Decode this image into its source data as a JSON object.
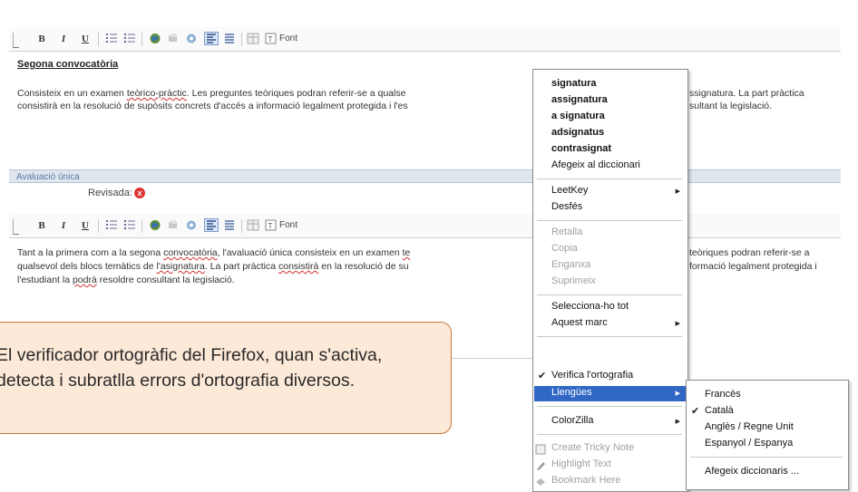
{
  "toolbar": {
    "bold": "B",
    "italic": "I",
    "underline": "U",
    "font": "Font"
  },
  "segona": {
    "heading": "Segona convocatòria",
    "line1_a": "Consisteix en un examen ",
    "line1_b": "teòrico-pràctic",
    "line1_c": ". Les preguntes teòriques podran referir-se a qualse",
    "line1_d": "ssignatura. La part pràctica",
    "line2_a": "consistirà en la resolució de supòsits concrets d'accés a informació legalment protegida i l'es",
    "line2_b": "sultant la legislació."
  },
  "section": {
    "title": "Avaluació única",
    "revisada_label": "Revisada:",
    "revisada_icon": "x"
  },
  "unica": {
    "line1_a": "Tant a la primera com a la segona ",
    "line1_b": "convocatòria",
    "line1_c": ", l'avaluació única consisteix en un examen ",
    "line1_d": "te",
    "line1_e": "teòriques podran referir-se a",
    "line2_a": "qualsevol dels blocs temàtics de ",
    "line2_b": "l'asignatura",
    "line2_c": ". La part pràctica ",
    "line2_d": "consistirà",
    "line2_e": " en la resolució de su",
    "line2_f": "formació legalment protegida i",
    "line3_a": "l'estudiant la ",
    "line3_b": "podrà",
    "line3_c": " resoldre consultant la legislació."
  },
  "callout": {
    "text": "El verificador ortogràfic del Firefox, quan s'activa, detecta i subratlla errors d'ortografia diversos."
  },
  "context_menu": {
    "suggestions": [
      "signatura",
      "assignatura",
      "a signatura",
      "adsignatus",
      "contrasignat"
    ],
    "add_dictionary": "Afegeix al diccionari",
    "leetkey": "LeetKey",
    "undo": "Desfés",
    "cut": "Retalla",
    "copy": "Copia",
    "paste": "Enganxa",
    "delete": "Suprimeix",
    "select_all": "Selecciona-ho tot",
    "this_frame": "Aquest marc",
    "spellcheck": "Verifica l'ortografia",
    "languages": "Llengües",
    "colorzilla": "ColorZilla",
    "tricky_note": "Create Tricky Note",
    "highlight": "Highlight Text",
    "bookmark_here": "Bookmark Here"
  },
  "languages_menu": {
    "items": [
      "Francès",
      "Català",
      "Anglès / Regne Unit",
      "Espanyol / Espanya"
    ],
    "add_dictionaries": "Afegeix diccionaris ..."
  },
  "colors": {
    "highlight": "#3168c5",
    "callout_bg": "#fce9d8",
    "callout_border": "#c8773d",
    "section_bar": "#dfe6ee"
  }
}
